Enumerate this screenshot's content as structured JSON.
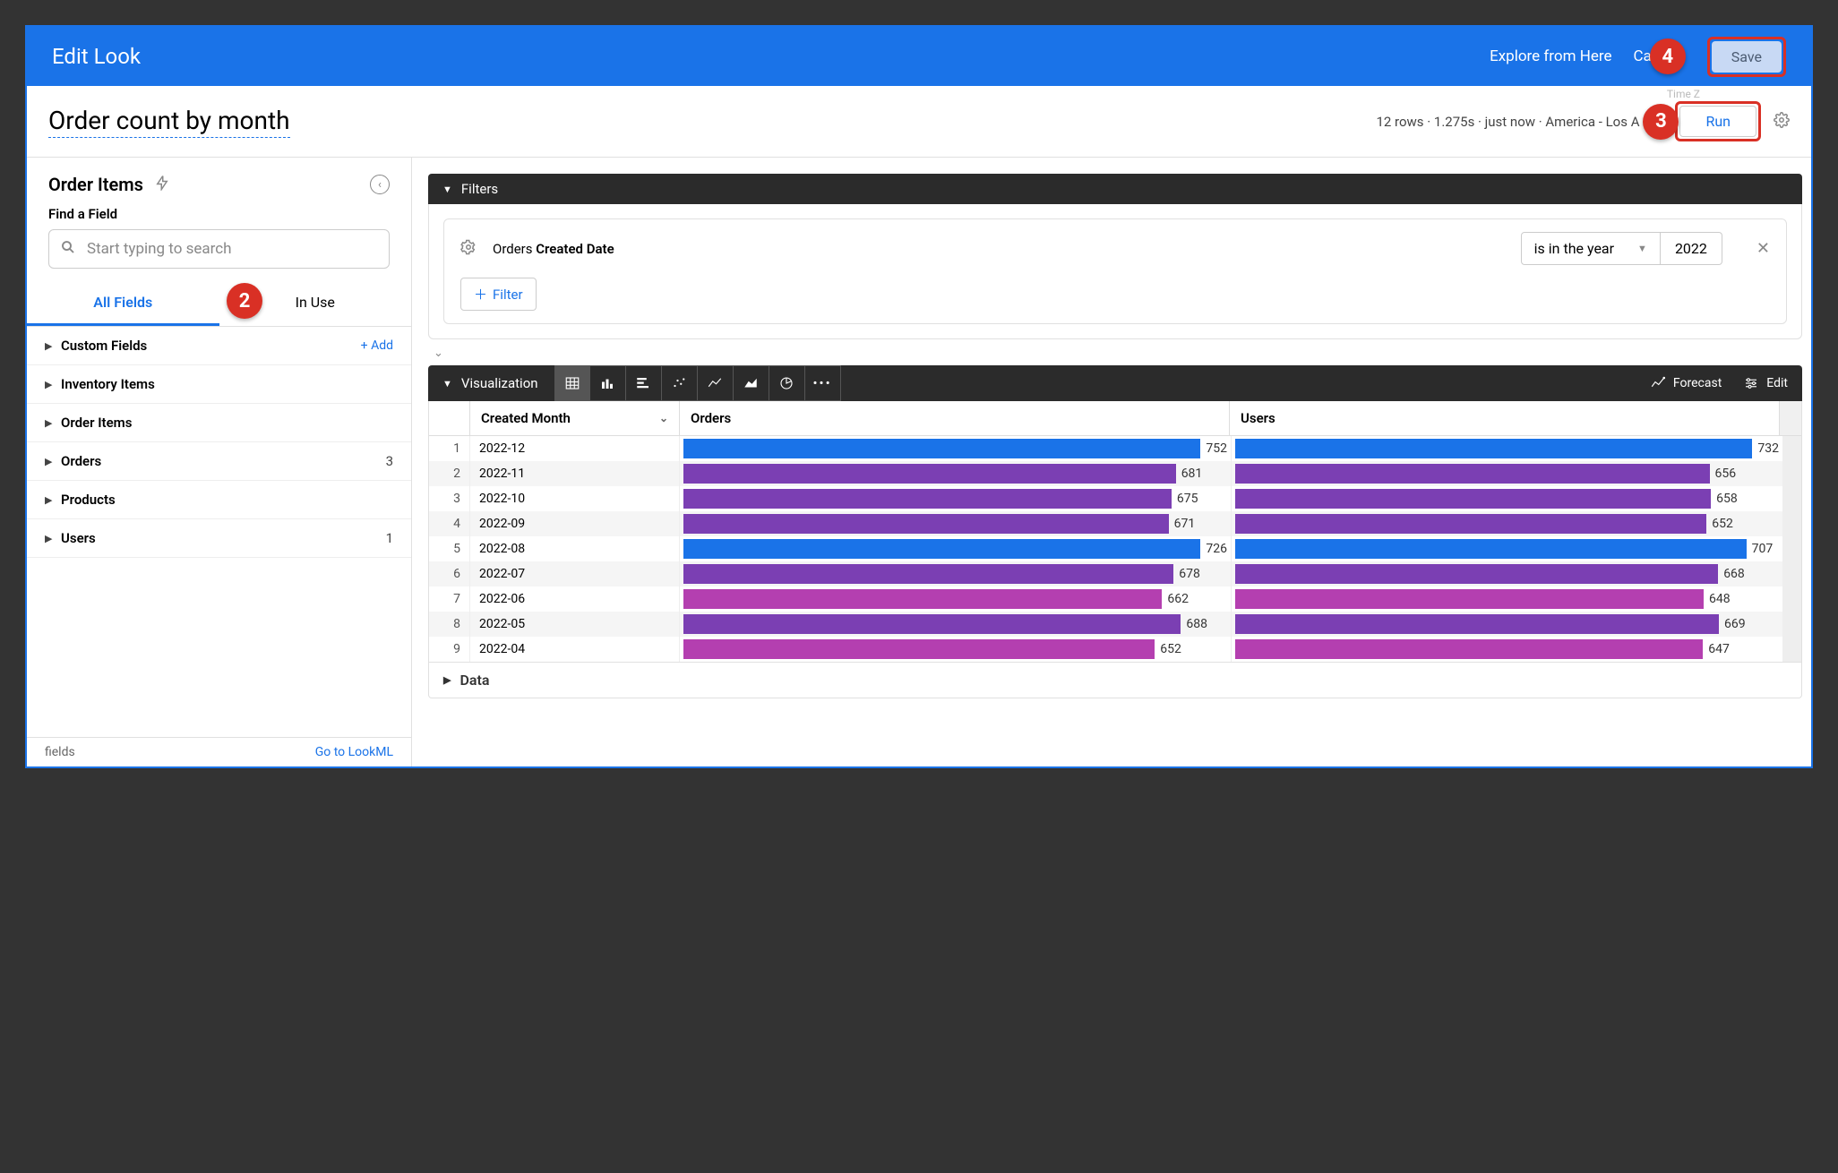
{
  "topbar": {
    "title": "Edit Look",
    "explore": "Explore from Here",
    "cancel": "Ca",
    "save": "Save"
  },
  "subhead": {
    "title": "Order count by month",
    "meta": "12 rows · 1.275s · just now · America - Los A",
    "tz": "Time Z",
    "run": "Run"
  },
  "sidebar": {
    "title": "Order Items",
    "find_label": "Find a Field",
    "search_placeholder": "Start typing to search",
    "tab_all": "All Fields",
    "tab_inuse": "In Use",
    "add": "+  Add",
    "rows": [
      {
        "label": "Custom Fields",
        "count": "",
        "add": true
      },
      {
        "label": "Inventory Items",
        "count": ""
      },
      {
        "label": "Order Items",
        "count": ""
      },
      {
        "label": "Orders",
        "count": "3"
      },
      {
        "label": "Products",
        "count": ""
      },
      {
        "label": "Users",
        "count": "1"
      }
    ],
    "foot_l": "fields",
    "foot_r": "Go to LookML"
  },
  "filters": {
    "band": "Filters",
    "label_pre": "Orders ",
    "label_bold": "Created Date",
    "op": "is in the year",
    "year": "2022",
    "add": "Filter"
  },
  "viz": {
    "band": "Visualization",
    "forecast": "Forecast",
    "edit": "Edit"
  },
  "table": {
    "h_month": "Created Month",
    "h_orders": "Orders",
    "h_users": "Users"
  },
  "data_band": "Data",
  "badges": {
    "b2": "2",
    "b3": "3",
    "b4": "4"
  },
  "chart_data": {
    "type": "table",
    "columns": [
      "Created Month",
      "Orders",
      "Users"
    ],
    "rows": [
      {
        "n": 1,
        "month": "2022-12",
        "orders": 752,
        "users": 732,
        "color": "blue"
      },
      {
        "n": 2,
        "month": "2022-11",
        "orders": 681,
        "users": 656,
        "color": "purple"
      },
      {
        "n": 3,
        "month": "2022-10",
        "orders": 675,
        "users": 658,
        "color": "purple"
      },
      {
        "n": 4,
        "month": "2022-09",
        "orders": 671,
        "users": 652,
        "color": "purple"
      },
      {
        "n": 5,
        "month": "2022-08",
        "orders": 726,
        "users": 707,
        "color": "blue"
      },
      {
        "n": 6,
        "month": "2022-07",
        "orders": 678,
        "users": 668,
        "color": "purple"
      },
      {
        "n": 7,
        "month": "2022-06",
        "orders": 662,
        "users": 648,
        "color": "magenta"
      },
      {
        "n": 8,
        "month": "2022-05",
        "orders": 688,
        "users": 669,
        "color": "purple"
      },
      {
        "n": 9,
        "month": "2022-04",
        "orders": 652,
        "users": 647,
        "color": "magenta"
      }
    ],
    "bar_max": 752
  },
  "colors": {
    "blue": "#1a73e8",
    "purple": "#7b3fb3",
    "magenta": "#b43fb0"
  }
}
